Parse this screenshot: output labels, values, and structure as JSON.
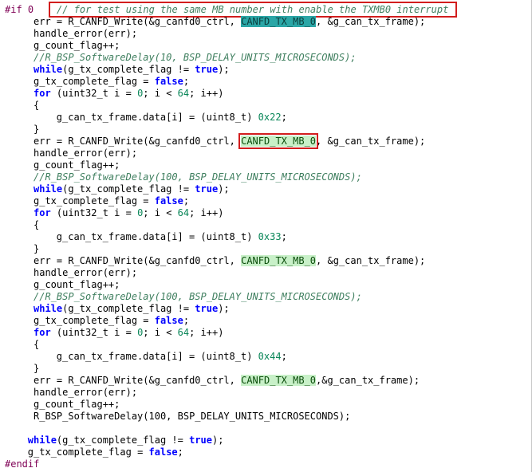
{
  "colors": {
    "preprocessor": "#7f0055",
    "keyword": "#0000ff",
    "comment": "#3f7f5f",
    "number": "#098658",
    "highlight_teal": "#2aa6a6",
    "highlight_green": "#c8f0c8",
    "annotation_red": "#d21e1e"
  },
  "lines": [
    {
      "indent": 0,
      "tokens": [
        {
          "t": "#if 0",
          "s": "pre"
        },
        {
          "t": "   ",
          "s": "pl"
        },
        {
          "t": " // for test using the same MB number with enable the TXMB0 interrupt ",
          "s": "cm",
          "box": true
        }
      ]
    },
    {
      "indent": 5,
      "tokens": [
        {
          "t": "err = R_CANFD_Write(&g_canfd0_ctrl, ",
          "s": "pl"
        },
        {
          "t": "CANFD_TX_MB_0",
          "s": "hl-teal"
        },
        {
          "t": ", &g_can_tx_frame);",
          "s": "pl"
        }
      ]
    },
    {
      "indent": 5,
      "tokens": [
        {
          "t": "handle_error(err);",
          "s": "pl"
        }
      ]
    },
    {
      "indent": 5,
      "tokens": [
        {
          "t": "g_count_flag++;",
          "s": "pl"
        }
      ]
    },
    {
      "indent": 5,
      "tokens": [
        {
          "t": "//R_BSP_SoftwareDelay(10, BSP_DELAY_UNITS_MICROSECONDS);",
          "s": "cm"
        }
      ]
    },
    {
      "indent": 5,
      "tokens": [
        {
          "t": "while",
          "s": "kw"
        },
        {
          "t": "(g_tx_complete_flag != ",
          "s": "pl"
        },
        {
          "t": "true",
          "s": "kw"
        },
        {
          "t": ");",
          "s": "pl"
        }
      ]
    },
    {
      "indent": 5,
      "tokens": [
        {
          "t": "g_tx_complete_flag = ",
          "s": "pl"
        },
        {
          "t": "false",
          "s": "kw"
        },
        {
          "t": ";",
          "s": "pl"
        }
      ]
    },
    {
      "indent": 5,
      "tokens": [
        {
          "t": "for",
          "s": "kw"
        },
        {
          "t": " (uint32_t i = ",
          "s": "pl"
        },
        {
          "t": "0",
          "s": "num"
        },
        {
          "t": "; i < ",
          "s": "pl"
        },
        {
          "t": "64",
          "s": "num"
        },
        {
          "t": "; i++)",
          "s": "pl"
        }
      ]
    },
    {
      "indent": 5,
      "tokens": [
        {
          "t": "{",
          "s": "pl"
        }
      ]
    },
    {
      "indent": 9,
      "tokens": [
        {
          "t": "g_can_tx_frame.data[i] = (uint8_t) ",
          "s": "pl"
        },
        {
          "t": "0x22",
          "s": "num"
        },
        {
          "t": ";",
          "s": "pl"
        }
      ]
    },
    {
      "indent": 5,
      "tokens": [
        {
          "t": "}",
          "s": "pl"
        }
      ]
    },
    {
      "indent": 5,
      "tokens": [
        {
          "t": "err = R_CANFD_Write(&g_canfd0_ctrl, ",
          "s": "pl"
        },
        {
          "t": "CANFD_TX_MB_0",
          "s": "hl-green",
          "box": true
        },
        {
          "t": ", &g_can_tx_frame);",
          "s": "pl"
        }
      ]
    },
    {
      "indent": 5,
      "tokens": [
        {
          "t": "handle_error(err);",
          "s": "pl"
        }
      ]
    },
    {
      "indent": 5,
      "tokens": [
        {
          "t": "g_count_flag++;",
          "s": "pl"
        }
      ]
    },
    {
      "indent": 5,
      "tokens": [
        {
          "t": "//R_BSP_SoftwareDelay(100, BSP_DELAY_UNITS_MICROSECONDS);",
          "s": "cm"
        }
      ]
    },
    {
      "indent": 5,
      "tokens": [
        {
          "t": "while",
          "s": "kw"
        },
        {
          "t": "(g_tx_complete_flag != ",
          "s": "pl"
        },
        {
          "t": "true",
          "s": "kw"
        },
        {
          "t": ");",
          "s": "pl"
        }
      ]
    },
    {
      "indent": 5,
      "tokens": [
        {
          "t": "g_tx_complete_flag = ",
          "s": "pl"
        },
        {
          "t": "false",
          "s": "kw"
        },
        {
          "t": ";",
          "s": "pl"
        }
      ]
    },
    {
      "indent": 5,
      "tokens": [
        {
          "t": "for",
          "s": "kw"
        },
        {
          "t": " (uint32_t i = ",
          "s": "pl"
        },
        {
          "t": "0",
          "s": "num"
        },
        {
          "t": "; i < ",
          "s": "pl"
        },
        {
          "t": "64",
          "s": "num"
        },
        {
          "t": "; i++)",
          "s": "pl"
        }
      ]
    },
    {
      "indent": 5,
      "tokens": [
        {
          "t": "{",
          "s": "pl"
        }
      ]
    },
    {
      "indent": 9,
      "tokens": [
        {
          "t": "g_can_tx_frame.data[i] = (uint8_t) ",
          "s": "pl"
        },
        {
          "t": "0x33",
          "s": "num"
        },
        {
          "t": ";",
          "s": "pl"
        }
      ]
    },
    {
      "indent": 5,
      "tokens": [
        {
          "t": "}",
          "s": "pl"
        }
      ]
    },
    {
      "indent": 5,
      "tokens": [
        {
          "t": "err = R_CANFD_Write(&g_canfd0_ctrl, ",
          "s": "pl"
        },
        {
          "t": "CANFD_TX_MB_0",
          "s": "hl-green"
        },
        {
          "t": ", &g_can_tx_frame);",
          "s": "pl"
        }
      ]
    },
    {
      "indent": 5,
      "tokens": [
        {
          "t": "handle_error(err);",
          "s": "pl"
        }
      ]
    },
    {
      "indent": 5,
      "tokens": [
        {
          "t": "g_count_flag++;",
          "s": "pl"
        }
      ]
    },
    {
      "indent": 5,
      "tokens": [
        {
          "t": "//R_BSP_SoftwareDelay(100, BSP_DELAY_UNITS_MICROSECONDS);",
          "s": "cm"
        }
      ]
    },
    {
      "indent": 5,
      "tokens": [
        {
          "t": "while",
          "s": "kw"
        },
        {
          "t": "(g_tx_complete_flag != ",
          "s": "pl"
        },
        {
          "t": "true",
          "s": "kw"
        },
        {
          "t": ");",
          "s": "pl"
        }
      ]
    },
    {
      "indent": 5,
      "tokens": [
        {
          "t": "g_tx_complete_flag = ",
          "s": "pl"
        },
        {
          "t": "false",
          "s": "kw"
        },
        {
          "t": ";",
          "s": "pl"
        }
      ]
    },
    {
      "indent": 5,
      "tokens": [
        {
          "t": "for",
          "s": "kw"
        },
        {
          "t": " (uint32_t i = ",
          "s": "pl"
        },
        {
          "t": "0",
          "s": "num"
        },
        {
          "t": "; i < ",
          "s": "pl"
        },
        {
          "t": "64",
          "s": "num"
        },
        {
          "t": "; i++)",
          "s": "pl"
        }
      ]
    },
    {
      "indent": 5,
      "tokens": [
        {
          "t": "{",
          "s": "pl"
        }
      ]
    },
    {
      "indent": 9,
      "tokens": [
        {
          "t": "g_can_tx_frame.data[i] = (uint8_t) ",
          "s": "pl"
        },
        {
          "t": "0x44",
          "s": "num"
        },
        {
          "t": ";",
          "s": "pl"
        }
      ]
    },
    {
      "indent": 5,
      "tokens": [
        {
          "t": "}",
          "s": "pl"
        }
      ]
    },
    {
      "indent": 5,
      "tokens": [
        {
          "t": "err = R_CANFD_Write(&g_canfd0_ctrl, ",
          "s": "pl"
        },
        {
          "t": "CANFD_TX_MB_0",
          "s": "hl-green"
        },
        {
          "t": ",&g_can_tx_frame);",
          "s": "pl"
        }
      ]
    },
    {
      "indent": 5,
      "tokens": [
        {
          "t": "handle_error(err);",
          "s": "pl"
        }
      ]
    },
    {
      "indent": 5,
      "tokens": [
        {
          "t": "g_count_flag++;",
          "s": "pl"
        }
      ]
    },
    {
      "indent": 5,
      "tokens": [
        {
          "t": "R_BSP_SoftwareDelay(100, BSP_DELAY_UNITS_MICROSECONDS);",
          "s": "pl"
        }
      ]
    },
    {
      "indent": 0,
      "tokens": []
    },
    {
      "indent": 4,
      "tokens": [
        {
          "t": "while",
          "s": "kw"
        },
        {
          "t": "(g_tx_complete_flag != ",
          "s": "pl"
        },
        {
          "t": "true",
          "s": "kw"
        },
        {
          "t": ");",
          "s": "pl"
        }
      ]
    },
    {
      "indent": 4,
      "tokens": [
        {
          "t": "g_tx_complete_flag = ",
          "s": "pl"
        },
        {
          "t": "false",
          "s": "kw"
        },
        {
          "t": ";",
          "s": "pl"
        }
      ]
    },
    {
      "indent": 0,
      "tokens": [
        {
          "t": "#endif",
          "s": "pre"
        }
      ]
    }
  ]
}
